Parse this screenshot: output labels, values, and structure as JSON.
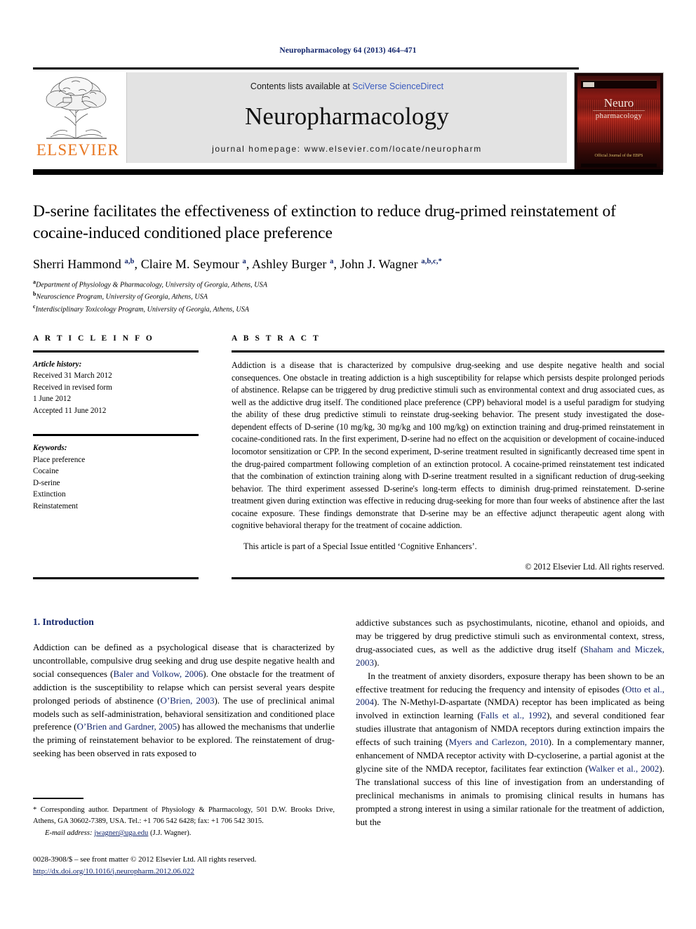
{
  "running_head": "Neuropharmacology 64 (2013) 464–471",
  "header": {
    "publisher_name": "ELSEVIER",
    "contents_prefix": "Contents lists available at ",
    "contents_link": "SciVerse ScienceDirect",
    "journal_title": "Neuropharmacology",
    "homepage": "journal homepage: www.elsevier.com/locate/neuropharm",
    "cover": {
      "title_line1": "Neuro",
      "title_line2": "pharmacology",
      "seal_text": "Official Journal of\nthe EBPS"
    }
  },
  "article": {
    "title": "D-serine facilitates the effectiveness of extinction to reduce drug-primed reinstatement of cocaine-induced conditioned place preference",
    "authors_html": "Sherri Hammond <sup>a,b</sup>, Claire M. Seymour <sup>a</sup>, Ashley Burger <sup>a</sup>, John J. Wagner <sup>a,b,c,</sup><sup>*</sup>",
    "affiliations": [
      {
        "marker": "a",
        "text": "Department of Physiology & Pharmacology, University of Georgia, Athens, USA"
      },
      {
        "marker": "b",
        "text": "Neuroscience Program, University of Georgia, Athens, USA"
      },
      {
        "marker": "c",
        "text": "Interdisciplinary Toxicology Program, University of Georgia, Athens, USA"
      }
    ]
  },
  "article_info": {
    "heading": "A R T I C L E  I N F O",
    "history_label": "Article history:",
    "history_lines": [
      "Received 31 March 2012",
      "Received in revised form",
      "1 June 2012",
      "Accepted 11 June 2012"
    ],
    "keywords_label": "Keywords:",
    "keywords": [
      "Place preference",
      "Cocaine",
      "D-serine",
      "Extinction",
      "Reinstatement"
    ]
  },
  "abstract": {
    "heading": "A B S T R A C T",
    "body": "Addiction is a disease that is characterized by compulsive drug-seeking and use despite negative health and social consequences. One obstacle in treating addiction is a high susceptibility for relapse which persists despite prolonged periods of abstinence. Relapse can be triggered by drug predictive stimuli such as environmental context and drug associated cues, as well as the addictive drug itself. The conditioned place preference (CPP) behavioral model is a useful paradigm for studying the ability of these drug predictive stimuli to reinstate drug-seeking behavior. The present study investigated the dose-dependent effects of D-serine (10 mg/kg, 30 mg/kg and 100 mg/kg) on extinction training and drug-primed reinstatement in cocaine-conditioned rats. In the first experiment, D-serine had no effect on the acquisition or development of cocaine-induced locomotor sensitization or CPP. In the second experiment, D-serine treatment resulted in significantly decreased time spent in the drug-paired compartment following completion of an extinction protocol. A cocaine-primed reinstatement test indicated that the combination of extinction training along with D-serine treatment resulted in a significant reduction of drug-seeking behavior. The third experiment assessed D-serine's long-term effects to diminish drug-primed reinstatement. D-serine treatment given during extinction was effective in reducing drug-seeking for more than four weeks of abstinence after the last cocaine exposure. These findings demonstrate that D-serine may be an effective adjunct therapeutic agent along with cognitive behavioral therapy for the treatment of cocaine addiction.",
    "special_issue": "This article is part of a Special Issue entitled ‘Cognitive Enhancers’.",
    "copyright": "© 2012 Elsevier Ltd. All rights reserved."
  },
  "introduction": {
    "heading": "1. Introduction",
    "left_paragraphs": [
      "Addiction can be defined as a psychological disease that is characterized by uncontrollable, compulsive drug seeking and drug use despite negative health and social consequences (Baler and Volkow, 2006). One obstacle for the treatment of addiction is the susceptibility to relapse which can persist several years despite prolonged periods of abstinence (O’Brien, 2003). The use of preclinical animal models such as self-administration, behavioral sensitization and conditioned place preference (O’Brien and Gardner, 2005) has allowed the mechanisms that underlie the priming of reinstatement behavior to be explored. The reinstatement of drug-seeking has been observed in rats exposed to"
    ],
    "right_paragraphs": [
      "addictive substances such as psychostimulants, nicotine, ethanol and opioids, and may be triggered by drug predictive stimuli such as environmental context, stress, drug-associated cues, as well as the addictive drug itself (Shaham and Miczek, 2003).",
      "In the treatment of anxiety disorders, exposure therapy has been shown to be an effective treatment for reducing the frequency and intensity of episodes (Otto et al., 2004). The N-Methyl-D-aspartate (NMDA) receptor has been implicated as being involved in extinction learning (Falls et al., 1992), and several conditioned fear studies illustrate that antagonism of NMDA receptors during extinction impairs the effects of such training (Myers and Carlezon, 2010). In a complementary manner, enhancement of NMDA receptor activity with D-cycloserine, a partial agonist at the glycine site of the NMDA receptor, facilitates fear extinction (Walker et al., 2002). The translational success of this line of investigation from an understanding of preclinical mechanisms in animals to promising clinical results in humans has prompted a strong interest in using a similar rationale for the treatment of addiction, but the"
    ]
  },
  "footnotes": {
    "corresponding": "* Corresponding author. Department of Physiology & Pharmacology, 501 D.W. Brooks Drive, Athens, GA 30602-7389, USA. Tel.: +1 706 542 6428; fax: +1 706 542 3015.",
    "email_label": "E-mail address:",
    "email": "jwagner@uga.edu",
    "email_suffix": "(J.J. Wagner)."
  },
  "imprint": {
    "line1": "0028-3908/$ – see front matter © 2012 Elsevier Ltd. All rights reserved.",
    "doi": "http://dx.doi.org/10.1016/j.neuropharm.2012.06.022"
  },
  "colors": {
    "link_blue": "#12256b",
    "sciencedirect_blue": "#3b5bbf",
    "elsevier_orange": "#e87722",
    "header_band": "#e3e3e3"
  }
}
